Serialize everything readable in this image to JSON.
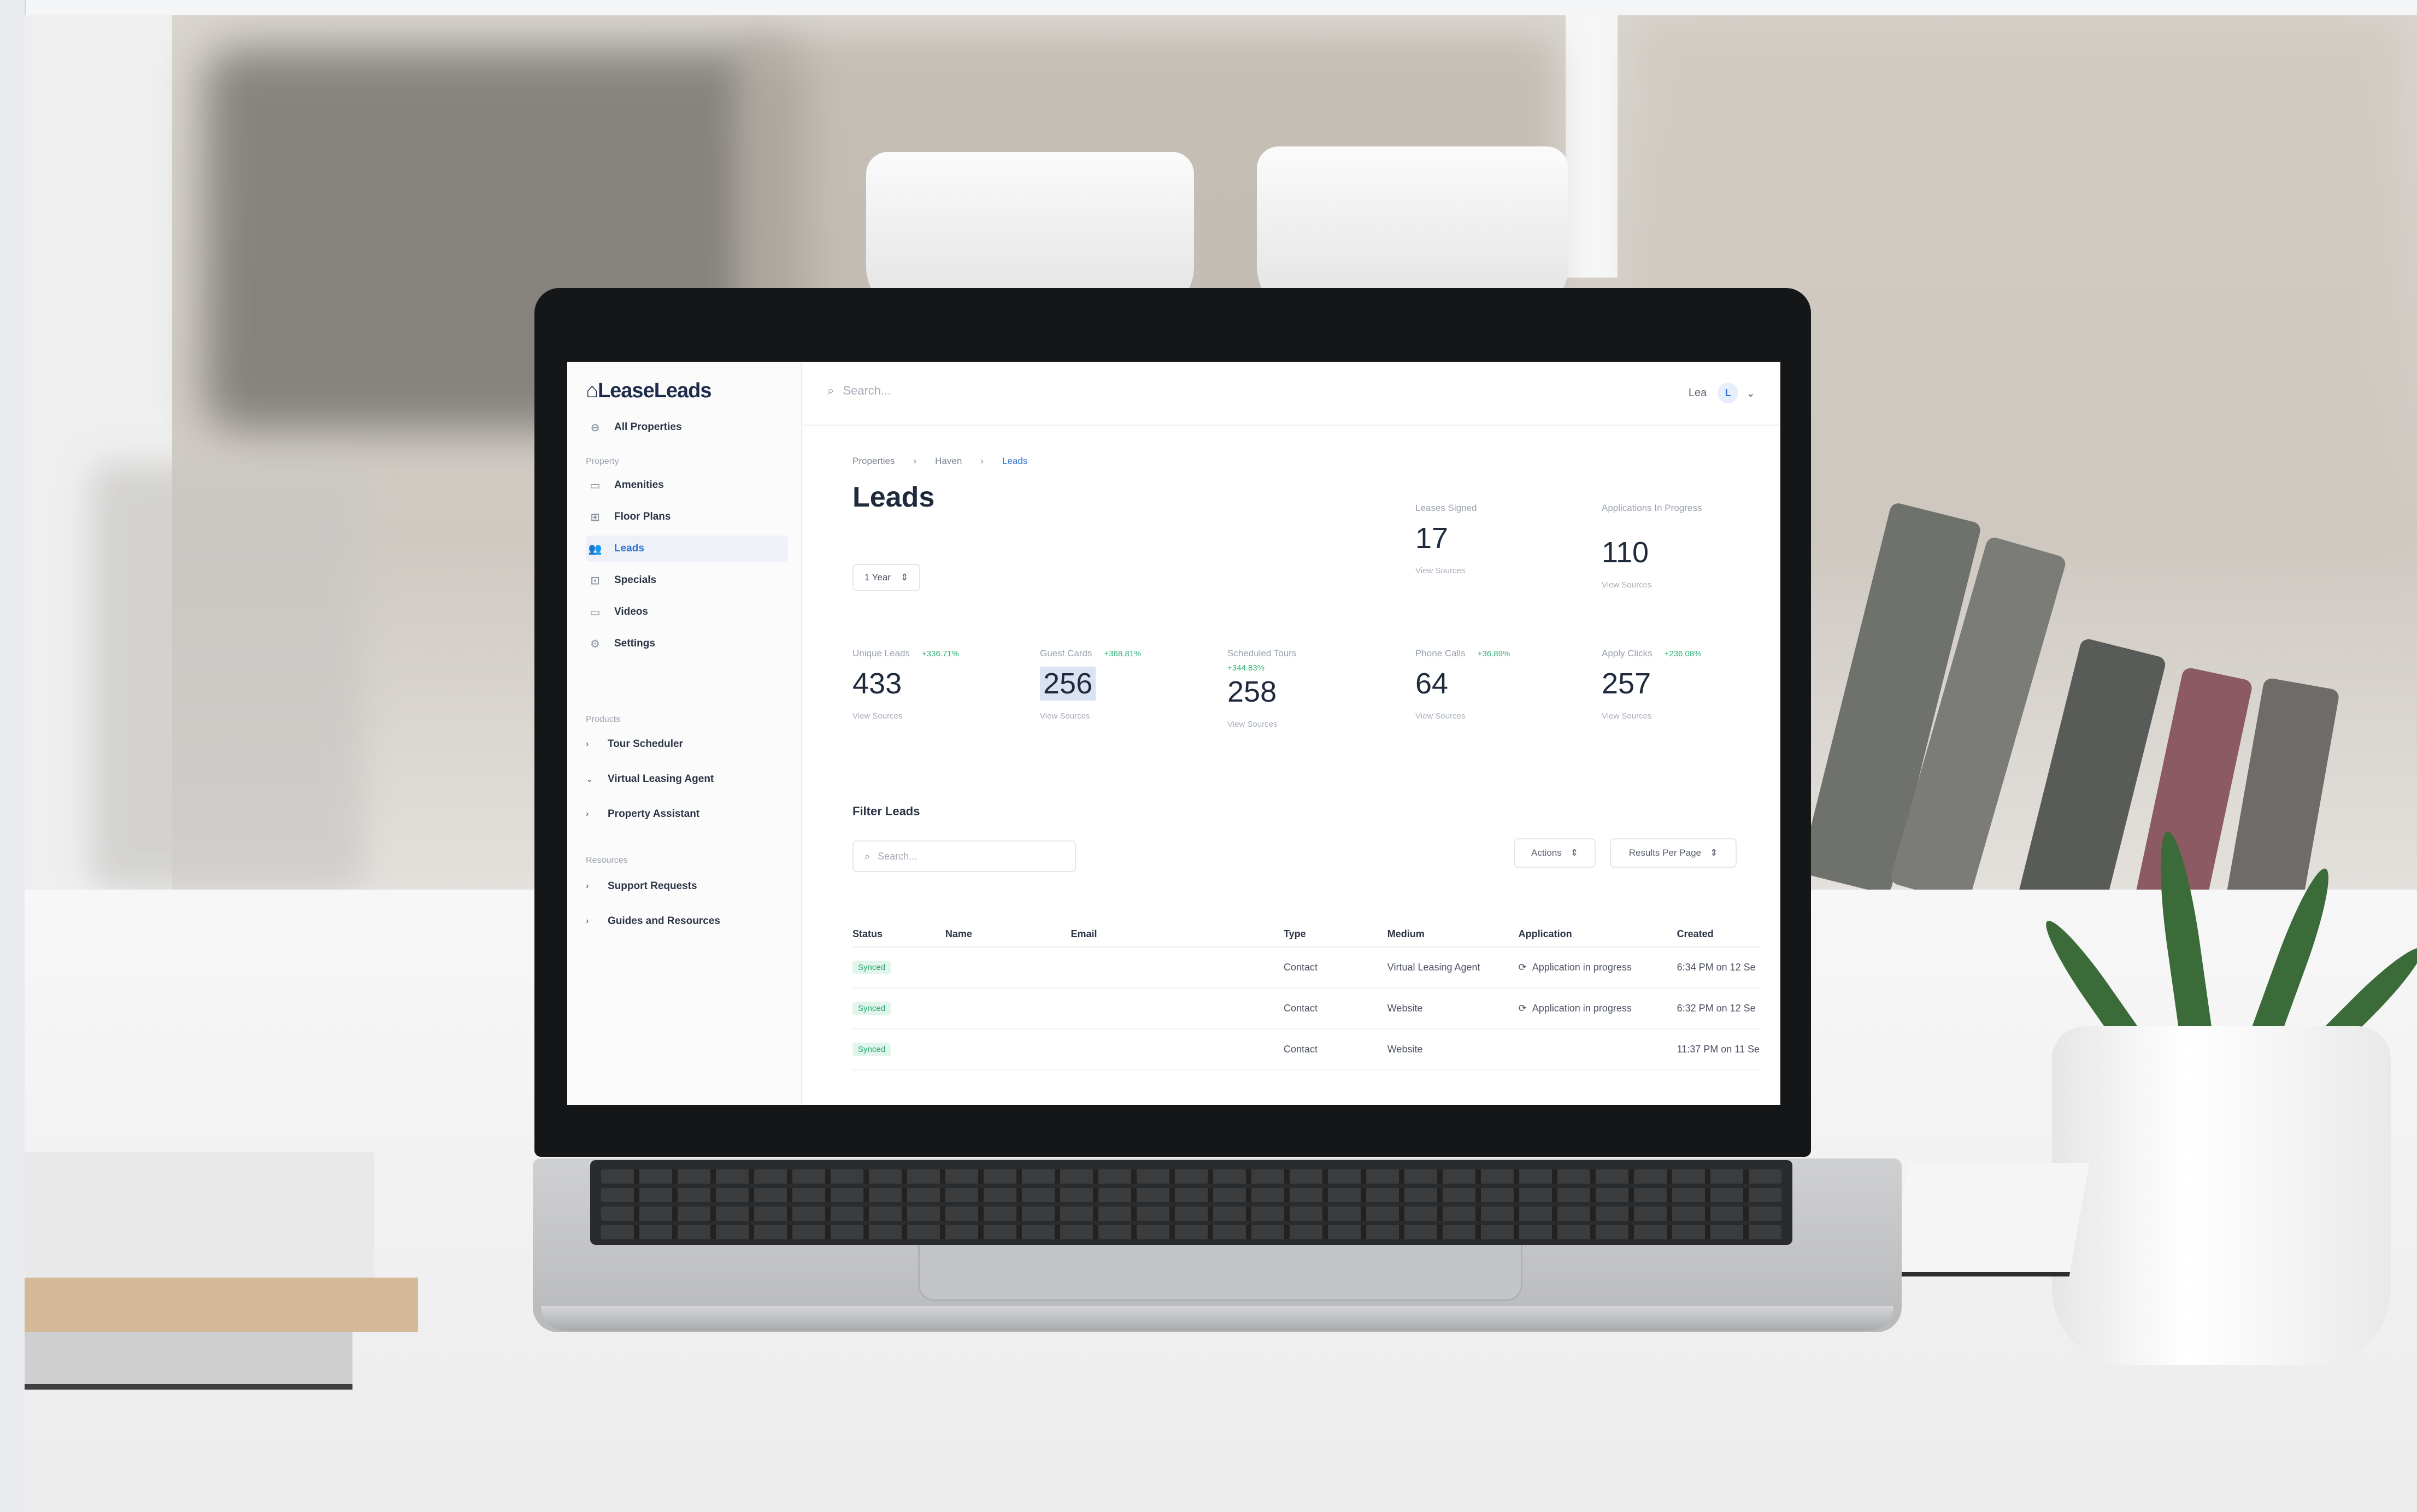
{
  "app": {
    "logo_text": "LeaseLeads"
  },
  "sidebar": {
    "all_properties": "All Properties",
    "sections": {
      "property": "Property",
      "products": "Products",
      "resources": "Resources"
    },
    "property_items": [
      {
        "label": "Amenities",
        "icon": "calendar-icon"
      },
      {
        "label": "Floor Plans",
        "icon": "grid-icon"
      },
      {
        "label": "Leads",
        "icon": "users-icon"
      },
      {
        "label": "Specials",
        "icon": "gift-icon"
      },
      {
        "label": "Videos",
        "icon": "video-icon"
      },
      {
        "label": "Settings",
        "icon": "gear-icon"
      }
    ],
    "product_items": [
      "Tour Scheduler",
      "Virtual Leasing Agent",
      "Property Assistant"
    ],
    "resource_items": [
      "Support Requests",
      "Guides and Resources"
    ]
  },
  "topbar": {
    "search_placeholder": "Search...",
    "user_name": "Lea",
    "user_initial": "L"
  },
  "breadcrumb": [
    "Properties",
    "Haven",
    "Leads"
  ],
  "page": {
    "title": "Leads",
    "range": "1 Year"
  },
  "stats_top": [
    {
      "label": "Leases Signed",
      "value": "17",
      "link": "View Sources"
    },
    {
      "label": "Applications In Progress",
      "value": "110",
      "link": "View Sources"
    }
  ],
  "stats": [
    {
      "label": "Unique Leads",
      "change": "+336.71%",
      "value": "433",
      "link": "View Sources"
    },
    {
      "label": "Guest Cards",
      "change": "+368.81%",
      "value": "256",
      "link": "View Sources"
    },
    {
      "label": "Scheduled Tours",
      "change": "+344.83%",
      "value": "258",
      "link": "View Sources"
    },
    {
      "label": "Phone Calls",
      "change": "+36.89%",
      "value": "64",
      "link": "View Sources"
    },
    {
      "label": "Apply Clicks",
      "change": "+236.08%",
      "value": "257",
      "link": "View Sources"
    }
  ],
  "filters": {
    "title": "Filter Leads",
    "search_placeholder": "Search...",
    "actions": "Actions",
    "per_page": "Results Per Page"
  },
  "table": {
    "columns": [
      "Status",
      "Name",
      "Email",
      "Type",
      "Medium",
      "Application",
      "Created"
    ],
    "rows": [
      {
        "status": "Synced",
        "name": "",
        "email": "",
        "type": "Contact",
        "medium": "Virtual Leasing Agent",
        "application": "Application in progress",
        "created": "6:34 PM on 12 Se"
      },
      {
        "status": "Synced",
        "name": "",
        "email": "",
        "type": "Contact",
        "medium": "Website",
        "application": "Application in progress",
        "created": "6:32 PM on 12 Se"
      },
      {
        "status": "Synced",
        "name": "",
        "email": "",
        "type": "Contact",
        "medium": "Website",
        "application": "",
        "created": "11:37 PM on 11 Se"
      }
    ]
  },
  "colors": {
    "accent": "#2f74d6",
    "positive": "#32b07a",
    "text": "#1f2a3d"
  }
}
